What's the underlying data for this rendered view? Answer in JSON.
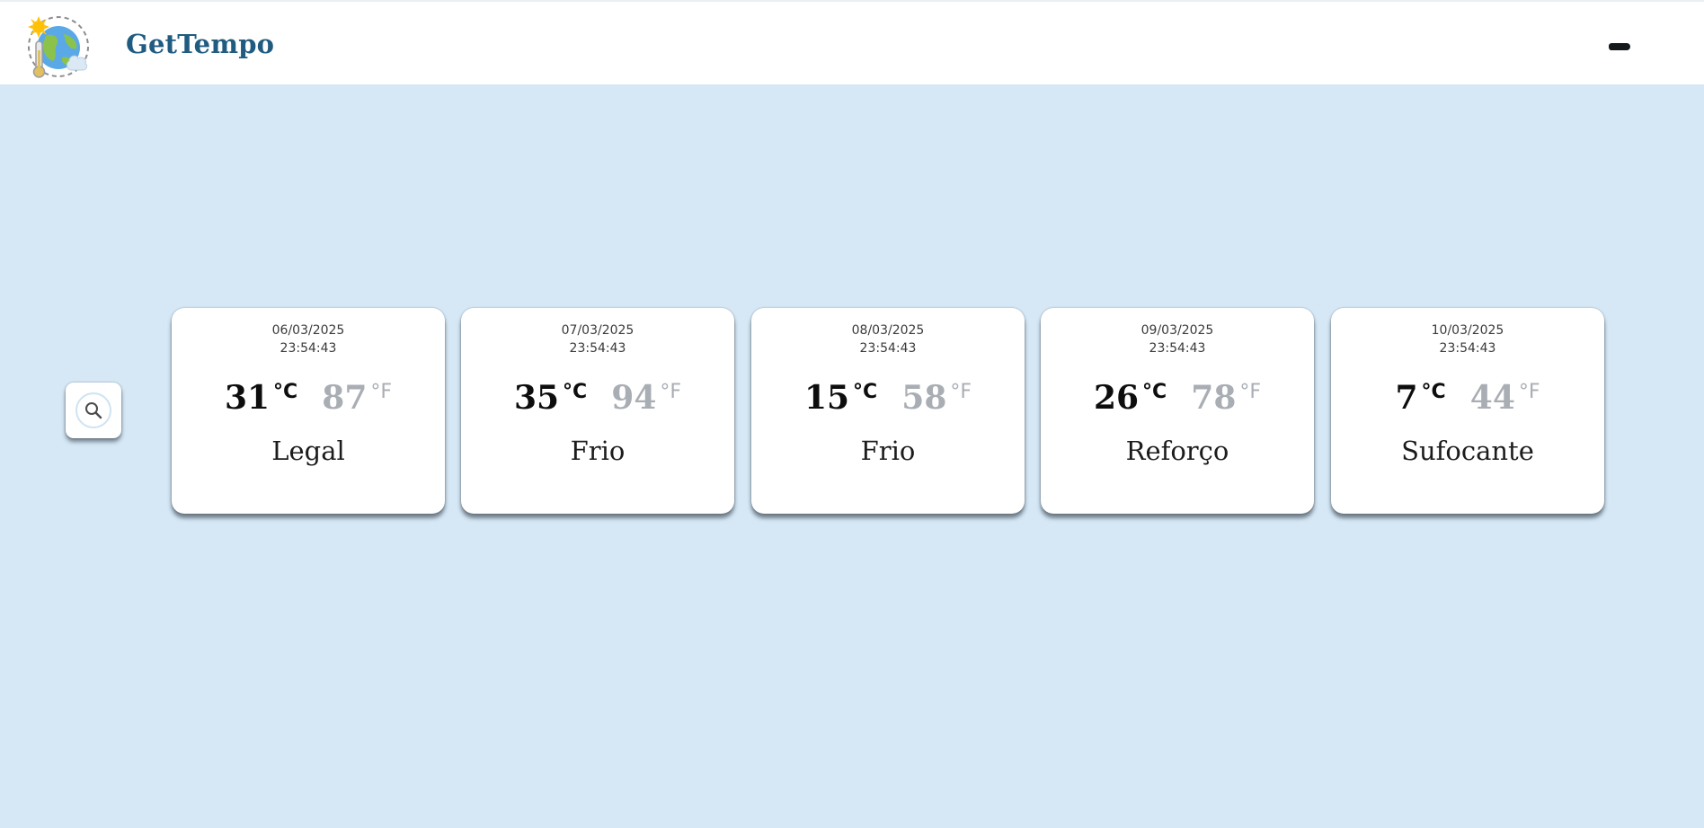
{
  "header": {
    "brand": "GetTempo",
    "logo_icon": "globe-weather-thermometer-icon",
    "menu_icon": "menu-toggle-icon"
  },
  "search": {
    "icon": "search-icon"
  },
  "forecast": [
    {
      "date": "06/03/2025",
      "time": "23:54:43",
      "temp_c": "31",
      "unit_c": "°C",
      "temp_f": "87",
      "unit_f": "°F",
      "description": "Legal"
    },
    {
      "date": "07/03/2025",
      "time": "23:54:43",
      "temp_c": "35",
      "unit_c": "°C",
      "temp_f": "94",
      "unit_f": "°F",
      "description": "Frio"
    },
    {
      "date": "08/03/2025",
      "time": "23:54:43",
      "temp_c": "15",
      "unit_c": "°C",
      "temp_f": "58",
      "unit_f": "°F",
      "description": "Frio"
    },
    {
      "date": "09/03/2025",
      "time": "23:54:43",
      "temp_c": "26",
      "unit_c": "°C",
      "temp_f": "78",
      "unit_f": "°F",
      "description": "Reforço"
    },
    {
      "date": "10/03/2025",
      "time": "23:54:43",
      "temp_c": "7",
      "unit_c": "°C",
      "temp_f": "44",
      "unit_f": "°F",
      "description": "Sufocante"
    }
  ],
  "colors": {
    "background": "#d6e8f6",
    "brand": "#1f5c80",
    "fahrenheit": "#a9adb4"
  }
}
